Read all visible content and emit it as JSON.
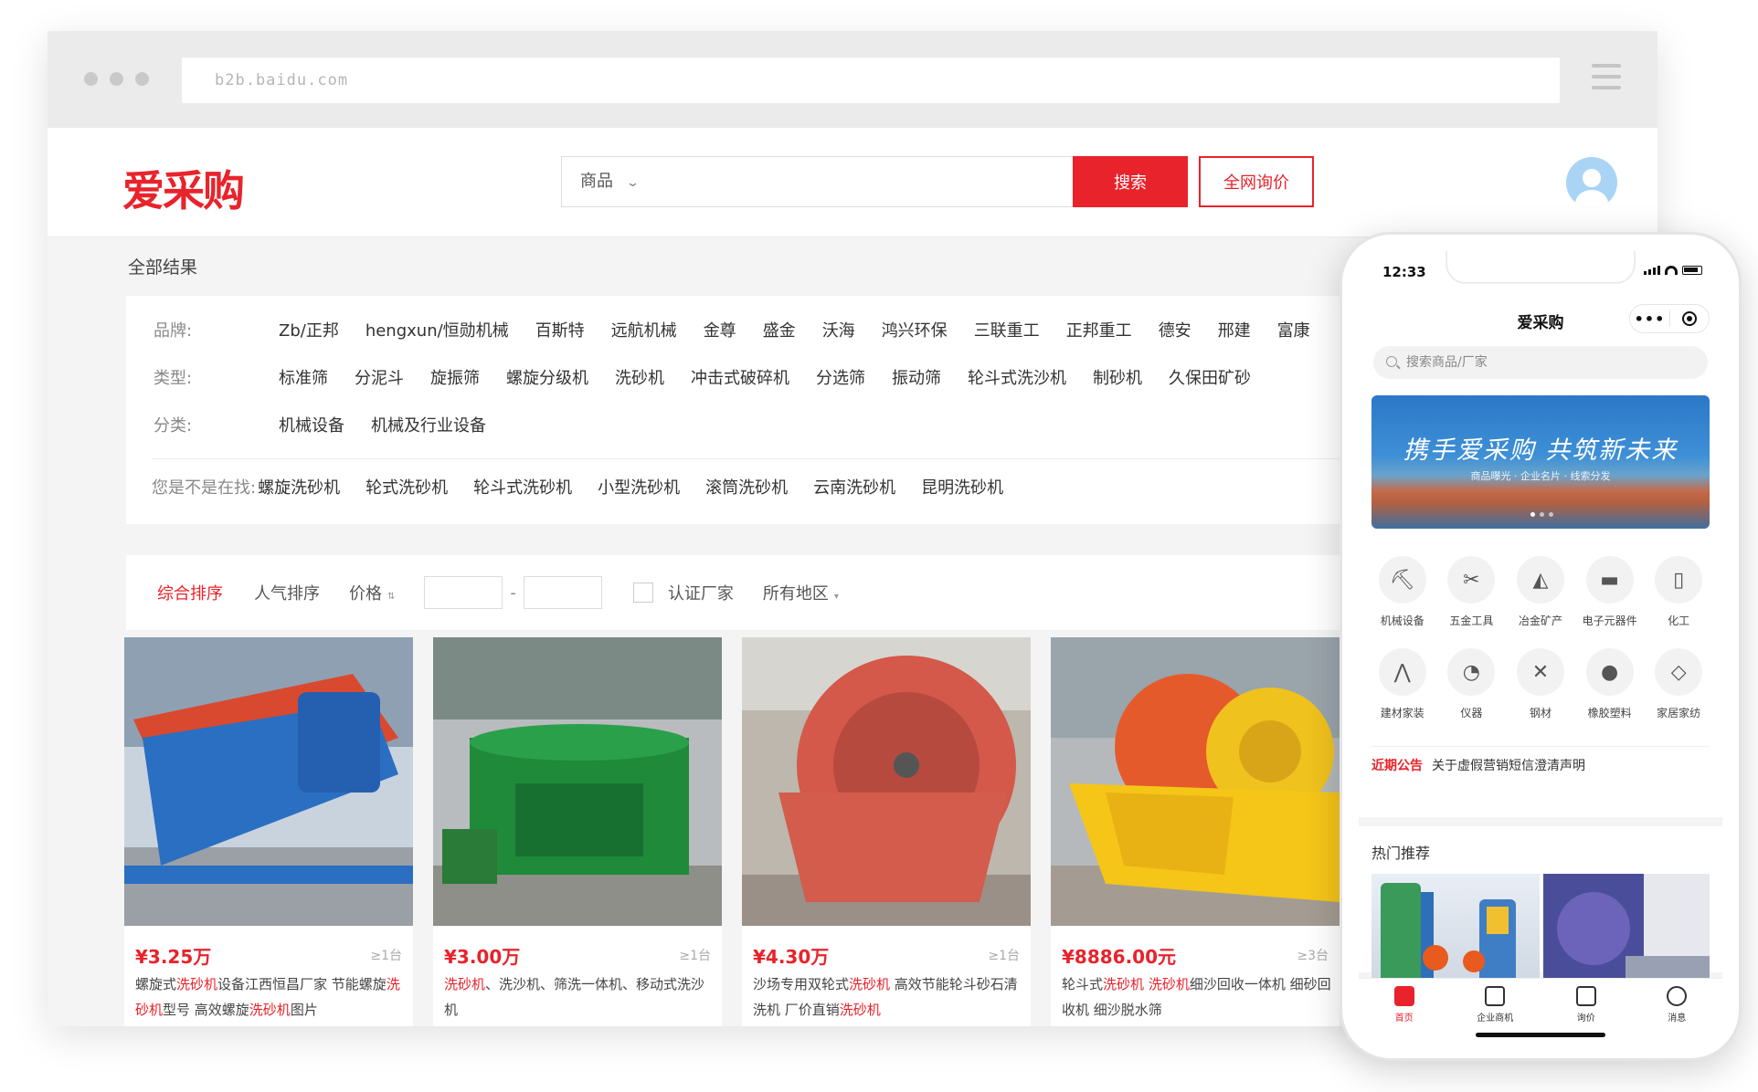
{
  "browser": {
    "url": "b2b.baidu.com"
  },
  "header": {
    "logo": "爱采购",
    "search_category": "商品",
    "search_placeholder": "",
    "search_button": "搜索",
    "inquiry_button": "全网询价"
  },
  "results": {
    "title": "全部结果",
    "filters": [
      {
        "label": "品牌:",
        "options": [
          "Zb/正邦",
          "hengxun/恒勋机械",
          "百斯特",
          "远航机械",
          "金尊",
          "盛金",
          "沃海",
          "鸿兴环保",
          "三联重工",
          "正邦重工",
          "德安",
          "邢建",
          "富康"
        ]
      },
      {
        "label": "类型:",
        "options": [
          "标准筛",
          "分泥斗",
          "旋振筛",
          "螺旋分级机",
          "洗砂机",
          "冲击式破碎机",
          "分选筛",
          "振动筛",
          "轮斗式洗沙机",
          "制砂机",
          "久保田矿砂"
        ]
      },
      {
        "label": "分类:",
        "options": [
          "机械设备",
          "机械及行业设备"
        ]
      }
    ],
    "suggest": {
      "label": "您是不是在找:",
      "options": [
        "螺旋洗砂机",
        "轮式洗砂机",
        "轮斗式洗砂机",
        "小型洗砂机",
        "滚筒洗砂机",
        "云南洗砂机",
        "昆明洗砂机"
      ]
    },
    "sort": {
      "items": [
        "综合排序",
        "人气排序",
        "价格"
      ],
      "certified": "认证厂家",
      "region": "所有地区"
    },
    "products": [
      {
        "price": "¥3.25万",
        "moq": "≥1台",
        "title_parts": [
          [
            "螺旋式",
            false
          ],
          [
            "洗砂机",
            true
          ],
          [
            "设备江西恒昌厂家 节能螺旋",
            false
          ],
          [
            "洗砂机",
            true
          ],
          [
            "型号 高效螺旋",
            false
          ],
          [
            "洗砂机",
            true
          ],
          [
            "图片",
            false
          ]
        ]
      },
      {
        "price": "¥3.00万",
        "moq": "≥1台",
        "title_parts": [
          [
            "洗砂机",
            true
          ],
          [
            "、洗沙机、筛洗一体机、移动式洗沙机",
            false
          ]
        ]
      },
      {
        "price": "¥4.30万",
        "moq": "≥1台",
        "title_parts": [
          [
            "沙场专用双轮式",
            false
          ],
          [
            "洗砂机",
            true
          ],
          [
            " 高效节能轮斗砂石清洗机 厂价直销",
            false
          ],
          [
            "洗砂机",
            true
          ]
        ]
      },
      {
        "price": "¥8886.00元",
        "moq": "≥3台",
        "title_parts": [
          [
            "轮斗式",
            false
          ],
          [
            "洗砂机",
            true
          ],
          [
            " ",
            false
          ],
          [
            "洗砂机",
            true
          ],
          [
            "细沙回收一体机 细砂回收机 细沙脱水筛",
            false
          ]
        ]
      }
    ]
  },
  "phone": {
    "time": "12:33",
    "title": "爱采购",
    "search_placeholder": "搜索商品/厂家",
    "banner_slogan": "携手爱采购 共筑新未来",
    "banner_sub": "商品曝光 · 企业名片 · 线索分发",
    "categories": [
      {
        "label": "机械设备",
        "icon": "excavator-icon"
      },
      {
        "label": "五金工具",
        "icon": "pliers-icon"
      },
      {
        "label": "冶金矿产",
        "icon": "ore-icon"
      },
      {
        "label": "电子元器件",
        "icon": "chip-icon"
      },
      {
        "label": "化工",
        "icon": "bag-icon"
      },
      {
        "label": "建材家装",
        "icon": "tripod-icon"
      },
      {
        "label": "仪器",
        "icon": "gauge-icon"
      },
      {
        "label": "钢材",
        "icon": "steel-icon"
      },
      {
        "label": "橡胶塑料",
        "icon": "rubber-icon"
      },
      {
        "label": "家居家纺",
        "icon": "pillow-icon"
      }
    ],
    "notice_tag": "近期公告",
    "notice_text": "关于虚假营销短信澄清声明",
    "hot_title": "热门推荐",
    "tabs": [
      {
        "label": "首页",
        "icon": "home-icon"
      },
      {
        "label": "企业商机",
        "icon": "business-icon"
      },
      {
        "label": "询价",
        "icon": "inquiry-icon"
      },
      {
        "label": "消息",
        "icon": "message-icon"
      }
    ]
  },
  "colors": {
    "accent": "#e8232b"
  }
}
